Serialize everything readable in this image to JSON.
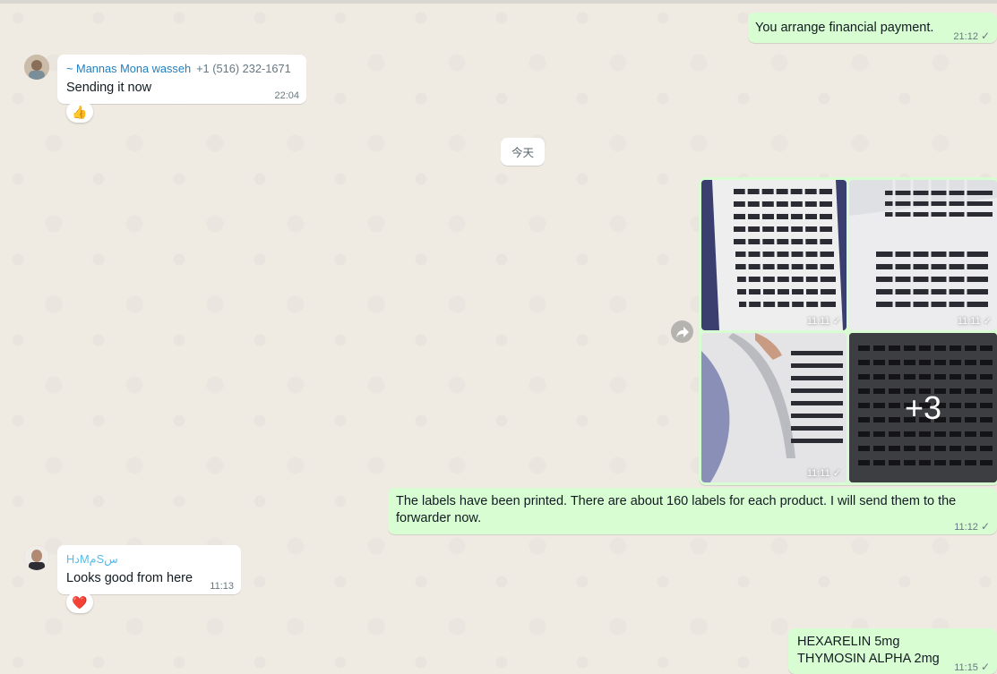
{
  "messages": {
    "m1": {
      "text": "You arrange financial payment.",
      "time": "21:12"
    },
    "m2": {
      "sender": "~ Mannas Mona wasseh",
      "phone": "+1 (516) 232-1671",
      "text": "Sending it now",
      "time": "22:04",
      "reaction": "👍"
    },
    "date_divider": "今天",
    "album": {
      "time1": "11:11",
      "time2": "11:11",
      "time3": "11:11",
      "more": "+3"
    },
    "m3": {
      "text": "The labels have been printed. There are about 160 labels for each product. I will send them to the forwarder now.",
      "time": "11:12"
    },
    "m4": {
      "sender": "HدMمSس",
      "text": "Looks good from here",
      "time": "11:13",
      "reaction": "❤️"
    },
    "m5": {
      "line1": "HEXARELIN 5mg",
      "line2": "THYMOSIN ALPHA 2mg",
      "time": "11:15"
    }
  },
  "colors": {
    "outgoing": "#d9fdd3",
    "incoming": "#ffffff",
    "background": "#efeae2",
    "sender1": "#1f7fbf",
    "sender2": "#53bdeb"
  },
  "icons": [
    "check-icon",
    "forward-icon",
    "thumbs-up-icon",
    "heart-icon"
  ]
}
